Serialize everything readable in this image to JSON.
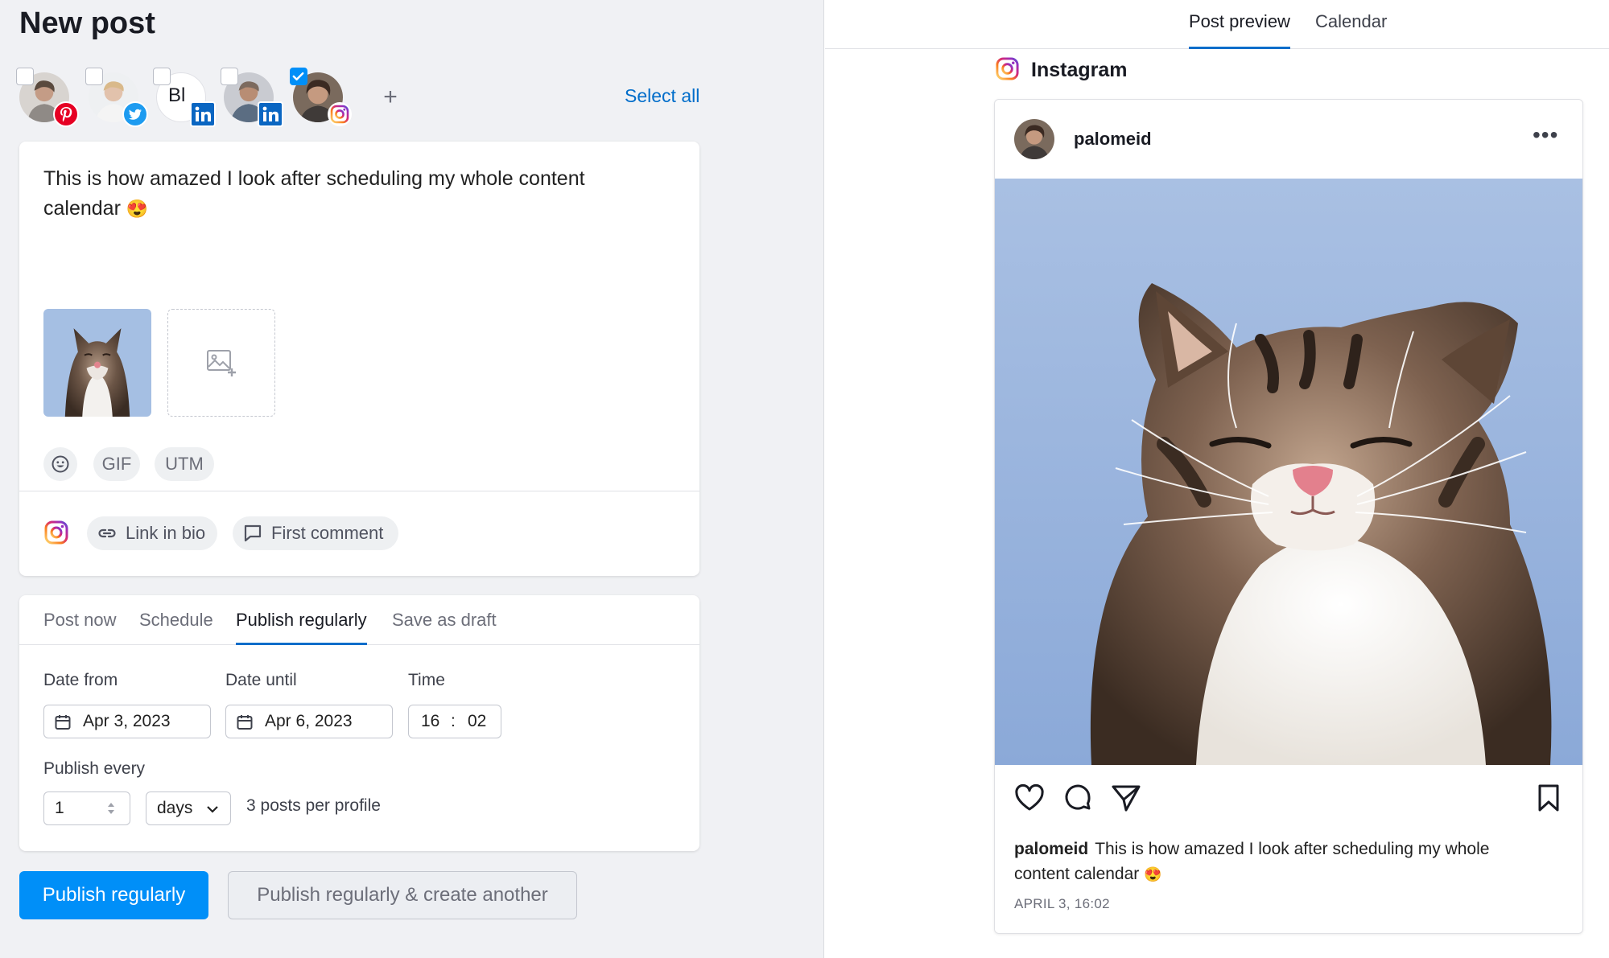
{
  "header": {
    "title": "New post"
  },
  "profiles": [
    {
      "network": "pinterest",
      "checked": false,
      "initials": ""
    },
    {
      "network": "twitter",
      "checked": false,
      "initials": ""
    },
    {
      "network": "linkedin",
      "checked": false,
      "initials": "Bl"
    },
    {
      "network": "linkedin",
      "checked": false,
      "initials": ""
    },
    {
      "network": "instagram",
      "checked": true,
      "initials": ""
    }
  ],
  "profiles_bar": {
    "add_label": "+",
    "select_all_label": "Select all"
  },
  "composer": {
    "text_line1": "This is how amazed I look after scheduling my whole content",
    "text_line2": "calendar",
    "emoji": "😍",
    "chips": {
      "gif": "GIF",
      "utm": "UTM"
    },
    "link_in_bio": "Link in bio",
    "first_comment": "First comment"
  },
  "schedule": {
    "tabs": [
      "Post now",
      "Schedule",
      "Publish regularly",
      "Save as draft"
    ],
    "active_tab": "Publish regularly",
    "date_from_label": "Date from",
    "date_from": "Apr 3, 2023",
    "date_until_label": "Date until",
    "date_until": "Apr 6, 2023",
    "time_label": "Time",
    "time_hour": "16",
    "time_sep": ":",
    "time_minute": "02",
    "publish_every_label": "Publish every",
    "publish_every_value": "1",
    "unit": "days",
    "posts_per_profile": "3 posts per profile"
  },
  "actions": {
    "primary": "Publish regularly",
    "secondary": "Publish regularly & create another"
  },
  "preview": {
    "tabs": [
      "Post preview",
      "Calendar"
    ],
    "active_tab": "Post preview",
    "network_title": "Instagram",
    "username": "palomeid",
    "more": "•••",
    "caption_line1": "This is how amazed I look after scheduling my whole",
    "caption_line2": "content calendar",
    "date": "APRIL 3, 16:02"
  },
  "colors": {
    "accent_blue": "#008ff8",
    "link_blue": "#006dca",
    "linkedin": "#0a66c2",
    "twitter": "#1d9bf0",
    "pinterest": "#e60023"
  },
  "icons": [
    "calendar-icon",
    "heart-icon",
    "comment-icon",
    "share-icon",
    "bookmark-icon",
    "link-icon",
    "chat-icon",
    "emoji-icon",
    "add-image-icon",
    "instagram-icon"
  ]
}
